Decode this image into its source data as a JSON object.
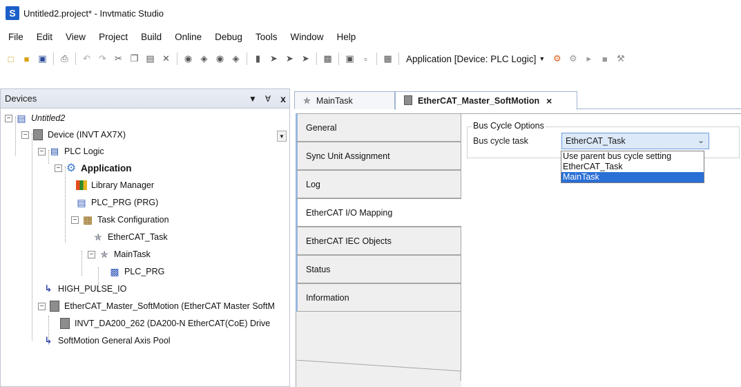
{
  "window": {
    "title": "Untitled2.project* - Invtmatic Studio",
    "logo_letter": "S"
  },
  "menu": [
    "File",
    "Edit",
    "View",
    "Project",
    "Build",
    "Online",
    "Debug",
    "Tools",
    "Window",
    "Help"
  ],
  "toolbar": {
    "active_application": "Application [Device: PLC Logic]"
  },
  "devices_panel": {
    "title": "Devices",
    "pin_symbol": " ⬍",
    "close_symbol": "x",
    "tree": [
      {
        "label": "Untitled2",
        "style": "italic"
      },
      {
        "label": "Device (INVT AX7X)"
      },
      {
        "label": "PLC Logic"
      },
      {
        "label": "Application",
        "style": "bold"
      },
      {
        "label": "Library Manager"
      },
      {
        "label": "PLC_PRG (PRG)"
      },
      {
        "label": "Task Configuration"
      },
      {
        "label": "EtherCAT_Task"
      },
      {
        "label": "MainTask"
      },
      {
        "label": "PLC_PRG"
      },
      {
        "label": "HIGH_PULSE_IO"
      },
      {
        "label": "EtherCAT_Master_SoftMotion (EtherCAT Master SoftM"
      },
      {
        "label": "INVT_DA200_262 (DA200-N EtherCAT(CoE) Drive"
      },
      {
        "label": "SoftMotion General Axis Pool"
      }
    ]
  },
  "editor_tabs": [
    {
      "label": "MainTask",
      "active": false
    },
    {
      "label": "EtherCAT_Master_SoftMotion",
      "active": true
    }
  ],
  "side_tabs": [
    {
      "label": "General"
    },
    {
      "label": "Sync Unit Assignment"
    },
    {
      "label": "Log"
    },
    {
      "label": "EtherCAT I/O Mapping",
      "active": true
    },
    {
      "label": "EtherCAT IEC Objects"
    },
    {
      "label": "Status"
    },
    {
      "label": "Information"
    }
  ],
  "bus_cycle": {
    "group_title": "Bus Cycle Options",
    "field_label": "Bus cycle task",
    "selected_value": "EtherCAT_Task",
    "options": [
      "Use parent bus cycle setting",
      "EtherCAT_Task",
      "MainTask"
    ],
    "highlighted_option": "MainTask"
  }
}
